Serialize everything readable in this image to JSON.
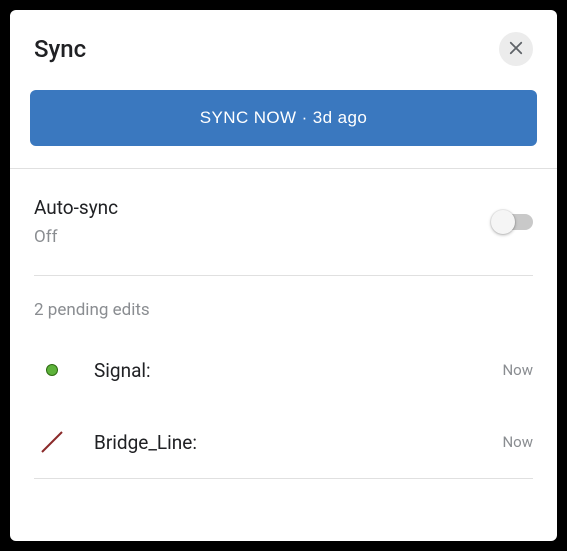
{
  "header": {
    "title": "Sync",
    "close_icon": "close"
  },
  "sync_button": {
    "label": "SYNC NOW · 3d ago"
  },
  "autosync": {
    "title": "Auto-sync",
    "status": "Off",
    "enabled": false
  },
  "pending": {
    "summary": "2 pending edits",
    "items": [
      {
        "icon": "point",
        "label": "Signal:",
        "time": "Now"
      },
      {
        "icon": "line",
        "label": "Bridge_Line:",
        "time": "Now"
      }
    ]
  }
}
